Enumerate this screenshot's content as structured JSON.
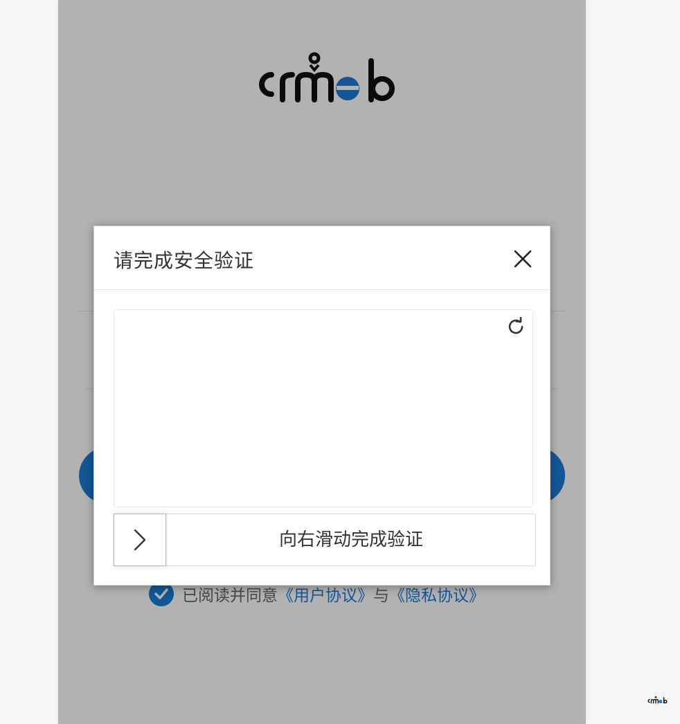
{
  "app": {
    "brand": "crmeb",
    "colors": {
      "accent": "#1a7bd6",
      "overlay": "rgba(0,0,0,0.3)",
      "text": "#333333"
    }
  },
  "login": {
    "agreement": {
      "prefix": "已阅读并同意",
      "user_agreement": "《用户协议》",
      "connector": "与",
      "privacy_policy": "《隐私协议》",
      "checked": true
    }
  },
  "captcha": {
    "title": "请完成安全验证",
    "close_icon": "close-icon",
    "refresh_icon": "refresh-icon",
    "slider_handle_icon": "chevron-right-icon",
    "slider_text": "向右滑动完成验证"
  }
}
